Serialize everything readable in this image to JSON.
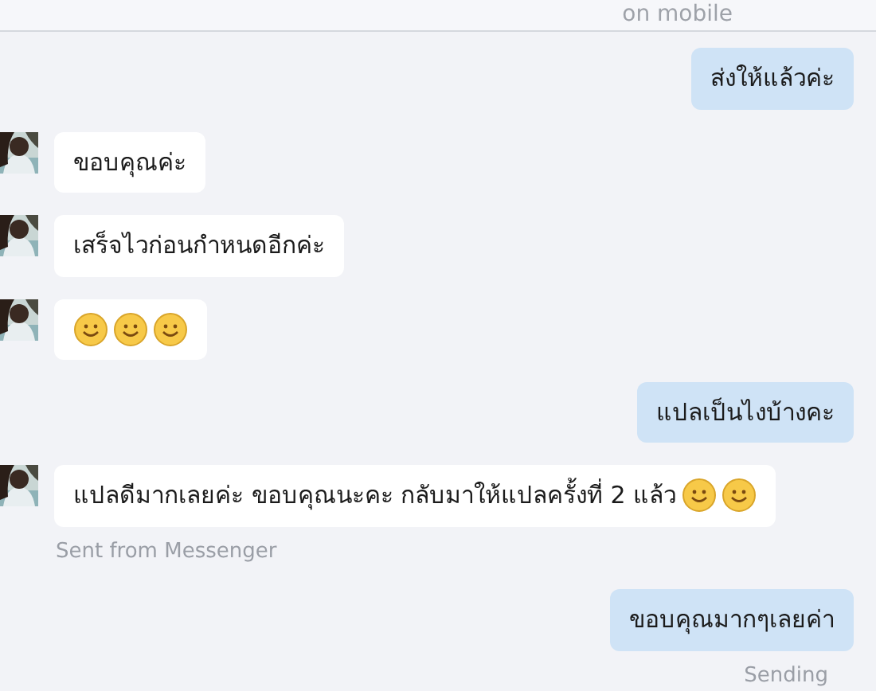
{
  "header": {
    "status": "on mobile"
  },
  "messages": [
    {
      "kind": "out",
      "parts": [
        {
          "kind": "text",
          "text": "ส่งให้แล้วค่ะ"
        }
      ]
    },
    {
      "kind": "in",
      "parts": [
        {
          "kind": "text",
          "text": "ขอบคุณค่ะ"
        }
      ]
    },
    {
      "kind": "in",
      "parts": [
        {
          "kind": "text",
          "text": "เสร็จไวก่อนกำหนดอีกค่ะ"
        }
      ]
    },
    {
      "kind": "in",
      "parts": [
        {
          "kind": "emoji"
        },
        {
          "kind": "emoji"
        },
        {
          "kind": "emoji"
        }
      ]
    },
    {
      "kind": "out",
      "parts": [
        {
          "kind": "text",
          "text": "แปลเป็นไงบ้างคะ"
        }
      ]
    },
    {
      "kind": "in",
      "parts": [
        {
          "kind": "text",
          "text": "แปลดีมากเลยค่ะ ขอบคุณนะคะ กลับมาให้แปลครั้งที่ 2 แล้ว"
        },
        {
          "kind": "emoji"
        },
        {
          "kind": "emoji"
        }
      ],
      "note": "Sent from Messenger"
    },
    {
      "kind": "out",
      "parts": [
        {
          "kind": "text",
          "text": "ขอบคุณมากๆเลยค่า"
        }
      ],
      "note": "Sending"
    }
  ]
}
